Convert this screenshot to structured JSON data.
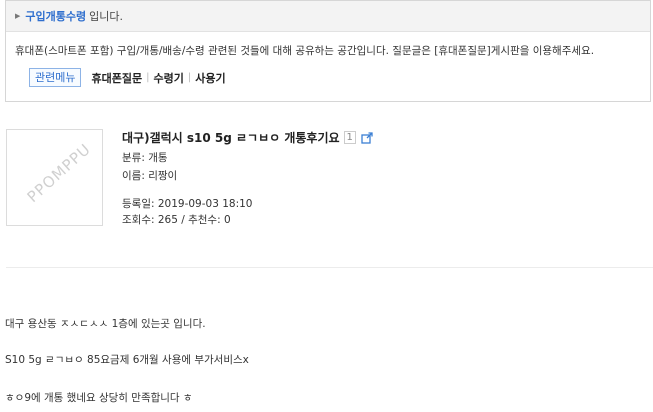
{
  "board": {
    "name": "구입개통수령",
    "suffix": "입니다.",
    "description": "휴대폰(스마트폰 포함) 구입/개통/배송/수령 관련된 것들에 대해 공유하는 공간입니다. 질문글은 [휴대폰질문]게시판을 이용해주세요.",
    "related_menu": "관련메뉴",
    "links": [
      "휴대폰질문",
      "수령기",
      "사용기"
    ]
  },
  "thumbnail": {
    "watermark": "PPOMPPU"
  },
  "post": {
    "title": "대구)갤럭시 s10 5g ㄹㄱㅂㅇ 개통후기요",
    "comment_count": "1",
    "category": "분류: 개통",
    "author": "이름: 리짱이",
    "date": "등록일: 2019-09-03 18:10",
    "stats": "조회수: 265 / 추천수: 0"
  },
  "content": {
    "lines": [
      "대구 용산동 ㅈㅅㄷㅅㅅ 1층에 있는곳 입니다.",
      "S10 5g ㄹㄱㅂㅇ 85요금제 6개월 사용에 부가서비스x",
      "ㅎㅇ9에 개통 했네요 상당히 만족합니다 ㅎ"
    ]
  }
}
